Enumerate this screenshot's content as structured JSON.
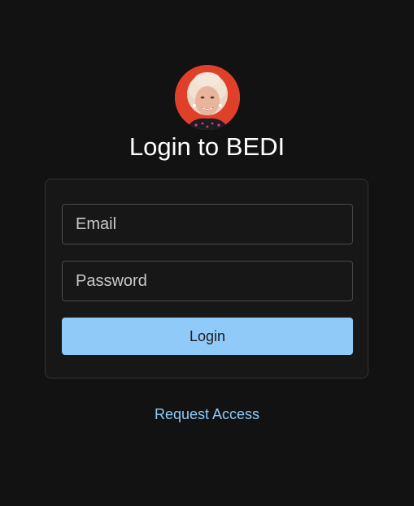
{
  "header": {
    "avatar_icon": "user-photo-avatar",
    "title": "Login to BEDI"
  },
  "form": {
    "email_placeholder": "Email",
    "email_value": "",
    "password_placeholder": "Password",
    "password_value": "",
    "login_label": "Login"
  },
  "footer": {
    "request_access_label": "Request Access"
  },
  "colors": {
    "background": "#121212",
    "card_background": "#171717",
    "accent": "#90caf9",
    "avatar_ring": "#e0402a"
  }
}
